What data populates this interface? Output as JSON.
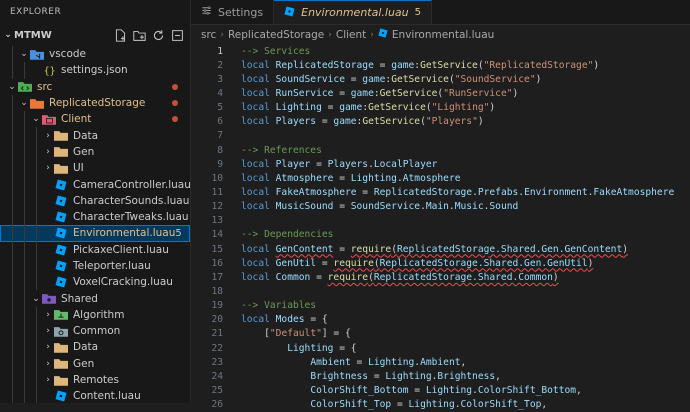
{
  "explorer": {
    "title": "EXPLORER",
    "project": "MTMW",
    "actions": [
      "new-file-icon",
      "new-folder-icon",
      "refresh-icon",
      "collapse-all-icon"
    ],
    "tree": [
      {
        "label": "vscode",
        "kind": "folder-vscode",
        "depth": 1,
        "expanded": true,
        "color": "#cccccc"
      },
      {
        "label": "settings.json",
        "kind": "json",
        "depth": 2,
        "color": "#cccccc"
      },
      {
        "label": "src",
        "kind": "folder-src",
        "depth": 0,
        "expanded": true,
        "color": "#e2c08d",
        "dot": true
      },
      {
        "label": "ReplicatedStorage",
        "kind": "folder-orange",
        "depth": 1,
        "expanded": true,
        "color": "#e2c08d",
        "dot": true
      },
      {
        "label": "Client",
        "kind": "folder-client",
        "depth": 2,
        "expanded": true,
        "color": "#e2c08d",
        "dot": true
      },
      {
        "label": "Data",
        "kind": "folder-yellow",
        "depth": 3,
        "expanded": false,
        "color": "#cccccc"
      },
      {
        "label": "Gen",
        "kind": "folder-yellow",
        "depth": 3,
        "expanded": false,
        "color": "#cccccc"
      },
      {
        "label": "UI",
        "kind": "folder-yellow",
        "depth": 3,
        "expanded": false,
        "color": "#cccccc"
      },
      {
        "label": "CameraController.luau",
        "kind": "luau",
        "depth": 3,
        "color": "#cccccc"
      },
      {
        "label": "CharacterSounds.luau",
        "kind": "luau",
        "depth": 3,
        "color": "#cccccc"
      },
      {
        "label": "CharacterTweaks.luau",
        "kind": "luau",
        "depth": 3,
        "color": "#cccccc"
      },
      {
        "label": "Environmental.luau",
        "kind": "luau",
        "depth": 3,
        "color": "#e2c08d",
        "badge": "5",
        "selected": true
      },
      {
        "label": "PickaxeClient.luau",
        "kind": "luau",
        "depth": 3,
        "color": "#cccccc"
      },
      {
        "label": "Teleporter.luau",
        "kind": "luau",
        "depth": 3,
        "color": "#cccccc"
      },
      {
        "label": "VoxelCracking.luau",
        "kind": "luau",
        "depth": 3,
        "color": "#cccccc"
      },
      {
        "label": "Shared",
        "kind": "folder-shared",
        "depth": 2,
        "expanded": true,
        "color": "#cccccc"
      },
      {
        "label": "Algorithm",
        "kind": "folder-green",
        "depth": 3,
        "expanded": false,
        "color": "#cccccc"
      },
      {
        "label": "Common",
        "kind": "folder-common",
        "depth": 3,
        "expanded": false,
        "color": "#cccccc"
      },
      {
        "label": "Data",
        "kind": "folder-yellow",
        "depth": 3,
        "expanded": false,
        "color": "#cccccc"
      },
      {
        "label": "Gen",
        "kind": "folder-yellow",
        "depth": 3,
        "expanded": false,
        "color": "#cccccc"
      },
      {
        "label": "Remotes",
        "kind": "folder-yellow",
        "depth": 3,
        "expanded": false,
        "color": "#cccccc"
      },
      {
        "label": "Content.luau",
        "kind": "luau",
        "depth": 3,
        "color": "#cccccc"
      }
    ]
  },
  "tabs": [
    {
      "label": "Settings",
      "icon": "settings-icon",
      "active": false
    },
    {
      "label": "Environmental.luau",
      "icon": "luau-file-icon",
      "active": true,
      "badge": "5"
    }
  ],
  "breadcrumb": [
    "src",
    "ReplicatedStorage",
    "Client",
    "Environmental.luau"
  ],
  "editor": {
    "current_line": 1,
    "lines": [
      [
        [
          "cm",
          "--> Services"
        ]
      ],
      [
        [
          "kw",
          "local "
        ],
        [
          "vr",
          "ReplicatedStorage"
        ],
        [
          "op",
          " = "
        ],
        [
          "vr",
          "game"
        ],
        [
          "op",
          ":"
        ],
        [
          "fn",
          "GetService"
        ],
        [
          "op",
          "("
        ],
        [
          "st",
          "\"ReplicatedStorage\""
        ],
        [
          "op",
          ")"
        ]
      ],
      [
        [
          "kw",
          "local "
        ],
        [
          "vr",
          "SoundService"
        ],
        [
          "op",
          " = "
        ],
        [
          "vr",
          "game"
        ],
        [
          "op",
          ":"
        ],
        [
          "fn",
          "GetService"
        ],
        [
          "op",
          "("
        ],
        [
          "st",
          "\"SoundService\""
        ],
        [
          "op",
          ")"
        ]
      ],
      [
        [
          "kw",
          "local "
        ],
        [
          "vr",
          "RunService"
        ],
        [
          "op",
          " = "
        ],
        [
          "vr",
          "game"
        ],
        [
          "op",
          ":"
        ],
        [
          "fn",
          "GetService"
        ],
        [
          "op",
          "("
        ],
        [
          "st",
          "\"RunService\""
        ],
        [
          "op",
          ")"
        ]
      ],
      [
        [
          "kw",
          "local "
        ],
        [
          "vr",
          "Lighting"
        ],
        [
          "op",
          " = "
        ],
        [
          "vr",
          "game"
        ],
        [
          "op",
          ":"
        ],
        [
          "fn",
          "GetService"
        ],
        [
          "op",
          "("
        ],
        [
          "st",
          "\"Lighting\""
        ],
        [
          "op",
          ")"
        ]
      ],
      [
        [
          "kw",
          "local "
        ],
        [
          "vr",
          "Players"
        ],
        [
          "op",
          " = "
        ],
        [
          "vr",
          "game"
        ],
        [
          "op",
          ":"
        ],
        [
          "fn",
          "GetService"
        ],
        [
          "op",
          "("
        ],
        [
          "st",
          "\"Players\""
        ],
        [
          "op",
          ")"
        ]
      ],
      [],
      [
        [
          "cm",
          "--> References"
        ]
      ],
      [
        [
          "kw",
          "local "
        ],
        [
          "vr",
          "Player"
        ],
        [
          "op",
          " = "
        ],
        [
          "vr",
          "Players"
        ],
        [
          "op",
          "."
        ],
        [
          "vr",
          "LocalPlayer"
        ]
      ],
      [
        [
          "kw",
          "local "
        ],
        [
          "vr",
          "Atmosphere"
        ],
        [
          "op",
          " = "
        ],
        [
          "vr",
          "Lighting"
        ],
        [
          "op",
          "."
        ],
        [
          "vr",
          "Atmosphere"
        ]
      ],
      [
        [
          "kw",
          "local "
        ],
        [
          "vr",
          "FakeAtmosphere"
        ],
        [
          "op",
          " = "
        ],
        [
          "vr",
          "ReplicatedStorage"
        ],
        [
          "op",
          "."
        ],
        [
          "vr",
          "Prefabs"
        ],
        [
          "op",
          "."
        ],
        [
          "vr",
          "Environment"
        ],
        [
          "op",
          "."
        ],
        [
          "vr",
          "FakeAtmosphere"
        ]
      ],
      [
        [
          "kw",
          "local "
        ],
        [
          "vr",
          "MusicSound"
        ],
        [
          "op",
          " = "
        ],
        [
          "vr",
          "SoundService"
        ],
        [
          "op",
          "."
        ],
        [
          "vr",
          "Main"
        ],
        [
          "op",
          "."
        ],
        [
          "vr",
          "Music"
        ],
        [
          "op",
          "."
        ],
        [
          "vr",
          "Sound"
        ]
      ],
      [],
      [
        [
          "cm",
          "--> Dependencies"
        ]
      ],
      [
        [
          "kw",
          "local "
        ],
        [
          "vr",
          "GenContent",
          "sq"
        ],
        [
          "op",
          " = "
        ],
        [
          "fn",
          "require",
          "sq"
        ],
        [
          "op",
          "(",
          "sq"
        ],
        [
          "vr",
          "ReplicatedStorage.Shared.Gen.GenContent",
          "sq"
        ],
        [
          "op",
          ")",
          "sq"
        ]
      ],
      [
        [
          "kw",
          "local "
        ],
        [
          "vr",
          "GenUtil"
        ],
        [
          "op",
          " = "
        ],
        [
          "fn",
          "require",
          "sq"
        ],
        [
          "op",
          "(",
          "sq"
        ],
        [
          "vr",
          "ReplicatedStorage.Shared.Gen.GenUtil",
          "sq"
        ],
        [
          "op",
          ")",
          "sq"
        ]
      ],
      [
        [
          "kw",
          "local "
        ],
        [
          "vr",
          "Common"
        ],
        [
          "op",
          " = "
        ],
        [
          "fn",
          "require",
          "sq"
        ],
        [
          "op",
          "(",
          "sq"
        ],
        [
          "vr",
          "ReplicatedStorage.Shared.Common",
          "sq"
        ],
        [
          "op",
          ")",
          "sq"
        ]
      ],
      [],
      [
        [
          "cm",
          "--> Variables"
        ]
      ],
      [
        [
          "kw",
          "local "
        ],
        [
          "vr",
          "Modes"
        ],
        [
          "op",
          " = {"
        ]
      ],
      [
        [
          "op",
          "    ["
        ],
        [
          "st",
          "\"Default\""
        ],
        [
          "op",
          "] = {"
        ]
      ],
      [
        [
          "op",
          "        "
        ],
        [
          "vr",
          "Lighting"
        ],
        [
          "op",
          " = {"
        ]
      ],
      [
        [
          "op",
          "            "
        ],
        [
          "vr",
          "Ambient"
        ],
        [
          "op",
          " = "
        ],
        [
          "vr",
          "Lighting"
        ],
        [
          "op",
          "."
        ],
        [
          "vr",
          "Ambient"
        ],
        [
          "op",
          ","
        ]
      ],
      [
        [
          "op",
          "            "
        ],
        [
          "vr",
          "Brightness"
        ],
        [
          "op",
          " = "
        ],
        [
          "vr",
          "Lighting"
        ],
        [
          "op",
          "."
        ],
        [
          "vr",
          "Brightness"
        ],
        [
          "op",
          ","
        ]
      ],
      [
        [
          "op",
          "            "
        ],
        [
          "vr",
          "ColorShift_Bottom"
        ],
        [
          "op",
          " = "
        ],
        [
          "vr",
          "Lighting"
        ],
        [
          "op",
          "."
        ],
        [
          "vr",
          "ColorShift_Bottom"
        ],
        [
          "op",
          ","
        ]
      ],
      [
        [
          "op",
          "            "
        ],
        [
          "vr",
          "ColorShift_Top"
        ],
        [
          "op",
          " = "
        ],
        [
          "vr",
          "Lighting"
        ],
        [
          "op",
          "."
        ],
        [
          "vr",
          "ColorShift_Top"
        ],
        [
          "op",
          ","
        ]
      ]
    ]
  },
  "colors": {
    "accent": "#0078d4",
    "modified": "#e2c08d",
    "error_dot": "#c74e39"
  }
}
